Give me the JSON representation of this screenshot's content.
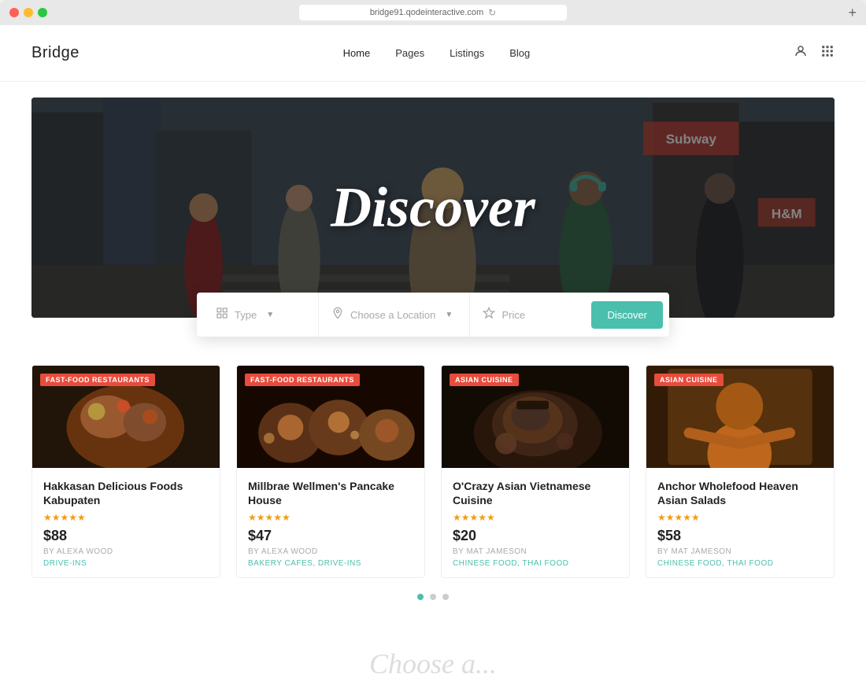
{
  "browser": {
    "url": "bridge91.qodeinteractive.com",
    "new_tab_icon": "+"
  },
  "nav": {
    "logo": "Bridge",
    "links": [
      {
        "label": "Home",
        "active": true
      },
      {
        "label": "Pages",
        "active": false
      },
      {
        "label": "Listings",
        "active": false
      },
      {
        "label": "Blog",
        "active": false
      }
    ],
    "user_icon": "👤",
    "menu_icon": "⊞"
  },
  "hero": {
    "title": "Discover"
  },
  "search": {
    "type_label": "Type",
    "location_label": "Choose a Location",
    "price_label": "Price",
    "button_label": "Discover"
  },
  "listings": {
    "cards": [
      {
        "badge": "FAST-FOOD RESTAURANTS",
        "badge_type": "red",
        "title": "Hakkasan Delicious Foods Kabupaten",
        "stars": 5,
        "price": "$88",
        "author": "BY ALEXA WOOD",
        "tags": "DRIVE-INS"
      },
      {
        "badge": "FAST-FOOD RESTAURANTS",
        "badge_type": "red",
        "title": "Millbrae Wellmen's Pancake House",
        "stars": 5,
        "price": "$47",
        "author": "BY ALEXA WOOD",
        "tags": "BAKERY CAFES, DRIVE-INS"
      },
      {
        "badge": "ASIAN CUISINE",
        "badge_type": "red",
        "title": "O'Crazy Asian Vietnamese Cuisine",
        "stars": 5,
        "price": "$20",
        "author": "BY MAT JAMESON",
        "tags": "CHINESE FOOD, THAI FOOD"
      },
      {
        "badge": "ASIAN CUISINE",
        "badge_type": "red",
        "title": "Anchor Wholefood Heaven Asian Salads",
        "stars": 5,
        "price": "$58",
        "author": "BY MAT JAMESON",
        "tags": "CHINESE FOOD, THAI FOOD"
      }
    ]
  },
  "pagination": {
    "dots": 3,
    "active": 0
  },
  "bottom": {
    "text": "Choose a..."
  }
}
